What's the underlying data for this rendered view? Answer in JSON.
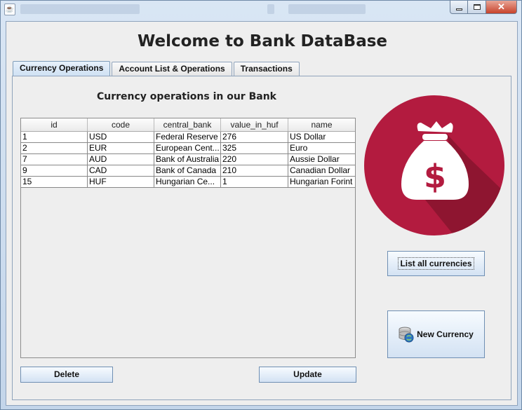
{
  "window": {
    "icon": "java-cup-icon",
    "controls": [
      "minimize-icon",
      "maximize-icon",
      "close-icon"
    ],
    "close_glyph": "✕"
  },
  "header": {
    "title": "Welcome to Bank DataBase"
  },
  "tabs": [
    {
      "label": "Currency Operations",
      "active": true
    },
    {
      "label": "Account List & Operations",
      "active": false
    },
    {
      "label": "Transactions",
      "active": false
    }
  ],
  "main": {
    "subtitle": "Currency operations in our Bank",
    "table": {
      "columns": [
        "id",
        "code",
        "central_bank",
        "value_in_huf",
        "name"
      ],
      "rows": [
        [
          "1",
          "USD",
          "Federal Reserve",
          "276",
          "US Dollar"
        ],
        [
          "2",
          "EUR",
          "European Cent...",
          "325",
          "Euro"
        ],
        [
          "7",
          "AUD",
          "Bank of Australia",
          "220",
          "Aussie Dollar"
        ],
        [
          "9",
          "CAD",
          "Bank of Canada",
          "210",
          "Canadian Dollar"
        ],
        [
          "15",
          "HUF",
          "Hungarian Ce...",
          "1",
          "Hungarian Forint"
        ]
      ]
    },
    "buttons": {
      "delete": "Delete",
      "update": "Update",
      "list_all": "List all currencies",
      "new_currency": "New Currency"
    },
    "logo_icon": "money-bag-icon",
    "logo_symbol": "$",
    "colors": {
      "logo_bg": "#b31b3f",
      "logo_shadow": "#8e1530",
      "accent": "#6f8fb3"
    }
  }
}
